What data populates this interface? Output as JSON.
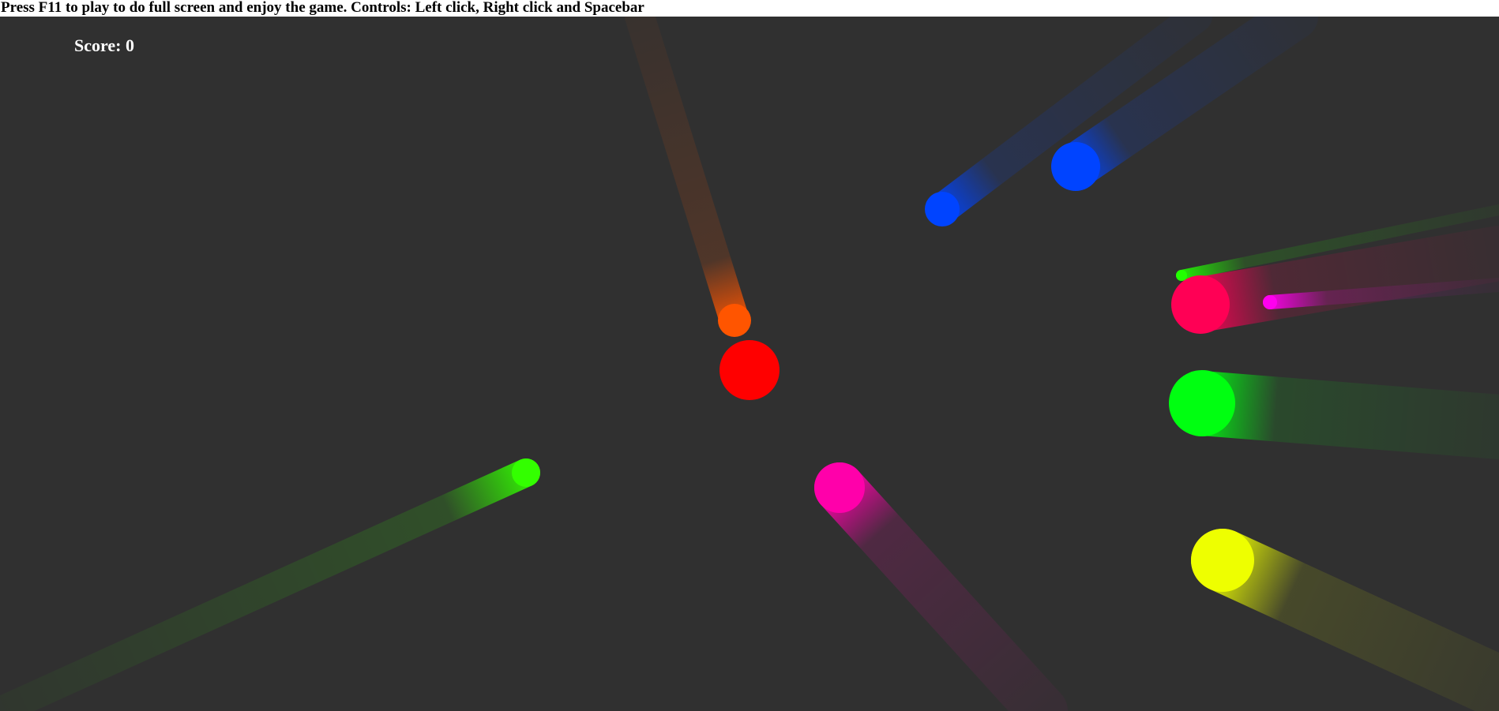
{
  "header": {
    "instructions": "Press F11 to play to do full screen and enjoy the game. Controls: Left click, Right click and Spacebar"
  },
  "hud": {
    "score_label": "Score: 0"
  },
  "colors": {
    "background": "#303030",
    "player": "#ff0000"
  },
  "player": {
    "color": "#ff0000"
  },
  "enemies": [
    {
      "name": "orange",
      "color": "#ff5500"
    },
    {
      "name": "blue-small",
      "color": "#0044ff"
    },
    {
      "name": "blue-large",
      "color": "#0044ff"
    },
    {
      "name": "crimson",
      "color": "#ff0055"
    },
    {
      "name": "magenta-small",
      "color": "#ff00ee"
    },
    {
      "name": "green-small",
      "color": "#22ff00"
    },
    {
      "name": "green-large",
      "color": "#00ff11"
    },
    {
      "name": "green-left",
      "color": "#33ff00"
    },
    {
      "name": "pink",
      "color": "#ff00aa"
    },
    {
      "name": "yellow",
      "color": "#eeff00"
    }
  ]
}
